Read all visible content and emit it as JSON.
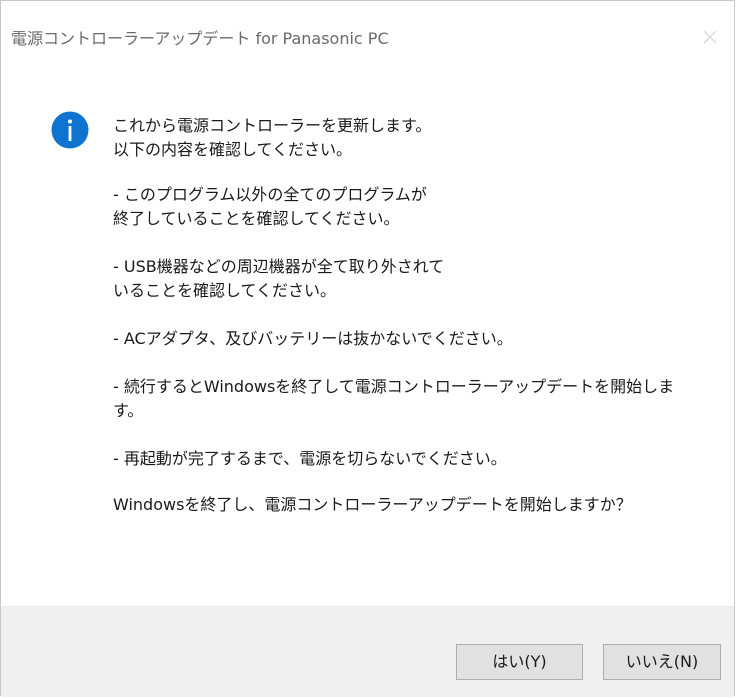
{
  "window": {
    "title": "電源コントローラーアップデート for Panasonic PC"
  },
  "icons": {
    "message": "info-icon",
    "close": "close-icon"
  },
  "colors": {
    "info_icon": "#0f74d0",
    "footer_bg": "#f0f0f0",
    "button_bg": "#e1e1e1"
  },
  "message": {
    "intro": "これから電源コントローラーを更新します。\n以下の内容を確認してください。",
    "items": [
      "- このプログラム以外の全てのプログラムが\n  終了していることを確認してください。",
      "- USB機器などの周辺機器が全て取り外されて\n  いることを確認してください。",
      "- ACアダプタ、及びバッテリーは抜かないでください。",
      "- 続行するとWindowsを終了して電源コントローラーアップデートを開始しま\nす。",
      "- 再起動が完了するまで、電源を切らないでください。"
    ],
    "question": "Windowsを終了し、電源コントローラーアップデートを開始しますか？"
  },
  "buttons": {
    "yes": "はい(Y)",
    "no": "いいえ(N)"
  }
}
